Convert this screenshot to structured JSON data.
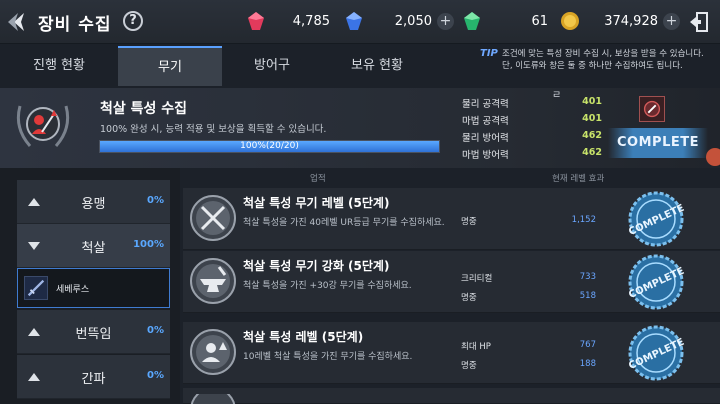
{
  "header": {
    "title": "장비 수집",
    "help_label": "?",
    "currencies": [
      {
        "icon": "red-gem-icon",
        "value": "4,785"
      },
      {
        "icon": "blue-gem-icon",
        "value": "2,050"
      },
      {
        "icon": "green-gem-icon",
        "value": "61"
      },
      {
        "icon": "gold-coin-icon",
        "value": "374,928"
      }
    ],
    "plus_label": "+"
  },
  "tabs": [
    "진행 현황",
    "무기",
    "방어구",
    "보유 현황"
  ],
  "active_tab": 1,
  "tip": {
    "tag": "TIP",
    "line1": "조건에 맞는 특성 장비 수집 시, 보상을 받을 수 있습니다.",
    "line2": "단, 이도류와 창은 둘 중 하나만 수집하여도 됩니다."
  },
  "summary": {
    "title": "척살 특성 수집",
    "desc": "100% 완성 시, 능력 적용 및 보상을 획득할 수 있습니다.",
    "progress_text": "100%(20/20)",
    "progress_fraction": 1.0,
    "marker": "ㄹ",
    "stats": [
      {
        "name": "물리 공격력",
        "value": "401"
      },
      {
        "name": "마법 공격력",
        "value": "401"
      },
      {
        "name": "물리 방어력",
        "value": "462"
      },
      {
        "name": "마법 방어력",
        "value": "462"
      }
    ],
    "complete_label": "COMPLETE"
  },
  "categories": [
    {
      "name": "용맹",
      "pct": "0%",
      "open": false
    },
    {
      "name": "척살",
      "pct": "100%",
      "open": true
    },
    {
      "name": "번뜩임",
      "pct": "0%",
      "open": false
    },
    {
      "name": "간파",
      "pct": "0%",
      "open": false
    }
  ],
  "sub_item": {
    "name": "세베루스"
  },
  "list_headers": {
    "achievement": "업적",
    "effect": "현재 레벨 효과"
  },
  "achievements": [
    {
      "title": "척살 특성 무기 레벨 (5단계)",
      "desc": "척살 특성을 가진 40레벨 UR등급 무기를 수집하세요.",
      "effects": [
        {
          "name": "명중",
          "value": "1,152"
        }
      ],
      "stamp": "COMPLETE"
    },
    {
      "title": "척살 특성 무기 강화 (5단계)",
      "desc": "척살 특성을 가진 +30강 무기를 수집하세요.",
      "effects": [
        {
          "name": "크리티컬",
          "value": "733"
        },
        {
          "name": "명중",
          "value": "518"
        }
      ],
      "stamp": "COMPLETE"
    },
    {
      "title": "척살 특성 레벨 (5단계)",
      "desc": "10레벨 척살 특성을 가진 무기를 수집하세요.",
      "effects": [
        {
          "name": "최대 HP",
          "value": "767"
        },
        {
          "name": "명중",
          "value": "188"
        }
      ],
      "stamp": "COMPLETE"
    }
  ],
  "colors": {
    "accent_blue": "#5aa8ff",
    "stat_green": "#c8e36a",
    "complete_blue": "#3c7fb8"
  }
}
